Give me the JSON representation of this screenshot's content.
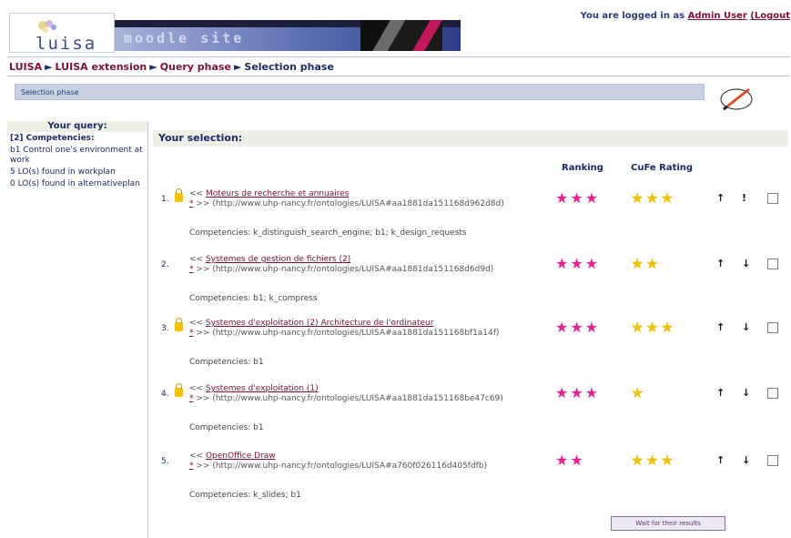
{
  "header": {
    "logo_text": "luisa",
    "site_name": "moodle site",
    "login_prefix": "You are logged in as",
    "login_user": "Admin User",
    "logout_label": "(Logout"
  },
  "breadcrumb": [
    "LUISA",
    "LUISA extension",
    "Query phase",
    "Selection phase"
  ],
  "phase_bar_label": "Selection phase",
  "sidebar": {
    "title": "Your query:",
    "competencies_label": "[2] Competencies:",
    "competency": "b1 Control one's environment at work",
    "workplan": "5 LO(s) found in workplan",
    "alternativeplan": "0 LO(s) found in alternativeplan"
  },
  "main": {
    "selection_title": "Your selection:",
    "col_ranking": "Ranking",
    "col_cufe": "CuFe Rating",
    "button_label": "Wait for their results"
  },
  "results": [
    {
      "num": "1.",
      "locked": true,
      "title": "Moteurs de recherche et annuaires",
      "uri": "(http://www.uhp-nancy.fr/ontologies/LUISA#aa1881da151168d962d8d)",
      "competencies": "Competencies: k_distinguish_search_engine; b1; k_design_requests",
      "ranking": 3,
      "cufe": 3,
      "up": "↑",
      "down": "!"
    },
    {
      "num": "2.",
      "locked": false,
      "title": "Systemes de gestion de fichiers (2)",
      "uri": "(http://www.uhp-nancy.fr/ontologies/LUISA#aa1881da151168d6d9d)",
      "competencies": "Competencies: b1; k_compress",
      "ranking": 3,
      "cufe": 2,
      "up": "↑",
      "down": "↓"
    },
    {
      "num": "3.",
      "locked": true,
      "title": "Systemes d'exploitation (2) Architecture de l'ordinateur",
      "uri": "(http://www.uhp-nancy.fr/ontologies/LUISA#aa1881da151168bf1a14f)",
      "competencies": "Competencies: b1",
      "ranking": 3,
      "cufe": 3,
      "up": "↑",
      "down": "↓"
    },
    {
      "num": "4.",
      "locked": true,
      "title": "Systemes d'exploitation (1)",
      "uri": "(http://www.uhp-nancy.fr/ontologies/LUISA#aa1881da151168be47c69)",
      "competencies": "Competencies: b1",
      "ranking": 3,
      "cufe": 1,
      "up": "↑",
      "down": "↓"
    },
    {
      "num": "5.",
      "locked": false,
      "title": "OpenOffice Draw",
      "uri": "(http://www.uhp-nancy.fr/ontologies/LUISA#a760f026116d405fdfb)",
      "competencies": "Competencies: k_slides; b1",
      "ranking": 2,
      "cufe": 3,
      "up": "↑",
      "down": "↓"
    }
  ],
  "colors": {
    "accent": "#7a1230",
    "nav": "#1c2a66",
    "pink_star": "#e0268a",
    "gold_star": "#f2c200"
  }
}
